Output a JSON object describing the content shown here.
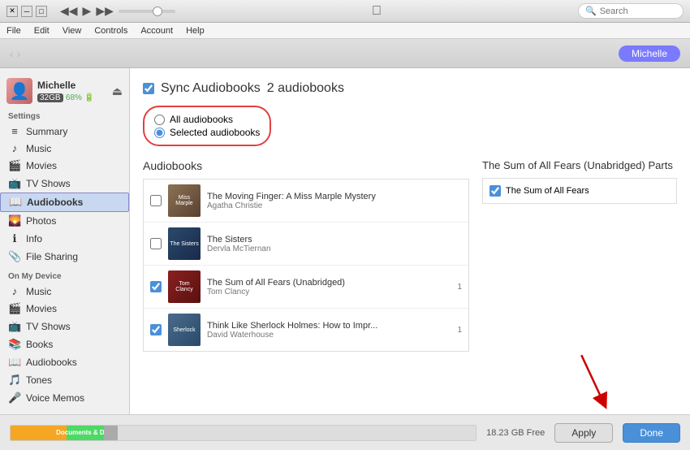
{
  "titleBar": {
    "windowControls": [
      "minimize",
      "maximize",
      "close"
    ],
    "transport": {
      "back": "◀◀",
      "play": "▶",
      "forward": "▶▶"
    },
    "appleLogoChar": "",
    "search": {
      "placeholder": "Search",
      "magnifier": "🔍"
    }
  },
  "menuBar": {
    "items": [
      "File",
      "Edit",
      "View",
      "Controls",
      "Account",
      "Help"
    ]
  },
  "navBar": {
    "backArrow": "‹",
    "forwardArrow": "›",
    "profileLabel": "Michelle"
  },
  "sidebar": {
    "device": {
      "name": "Michelle",
      "capacity": "32GB",
      "battery": "68% 🔋"
    },
    "settings": {
      "label": "Settings",
      "items": [
        {
          "id": "summary",
          "icon": "≡",
          "label": "Summary"
        },
        {
          "id": "music",
          "icon": "♪",
          "label": "Music"
        },
        {
          "id": "movies",
          "icon": "🎬",
          "label": "Movies"
        },
        {
          "id": "tvshows",
          "icon": "📺",
          "label": "TV Shows"
        },
        {
          "id": "audiobooks",
          "icon": "📖",
          "label": "Audiobooks",
          "active": true
        },
        {
          "id": "photos",
          "icon": "🌄",
          "label": "Photos"
        },
        {
          "id": "info",
          "icon": "ℹ",
          "label": "Info"
        },
        {
          "id": "filesharing",
          "icon": "📎",
          "label": "File Sharing"
        }
      ]
    },
    "onMyDevice": {
      "label": "On My Device",
      "items": [
        {
          "id": "music2",
          "icon": "♪",
          "label": "Music"
        },
        {
          "id": "movies2",
          "icon": "🎬",
          "label": "Movies"
        },
        {
          "id": "tvshows2",
          "icon": "📺",
          "label": "TV Shows"
        },
        {
          "id": "books",
          "icon": "📚",
          "label": "Books"
        },
        {
          "id": "audiobooks2",
          "icon": "📖",
          "label": "Audiobooks"
        },
        {
          "id": "tones",
          "icon": "🎵",
          "label": "Tones"
        },
        {
          "id": "voicememos",
          "icon": "🎤",
          "label": "Voice Memos"
        }
      ]
    }
  },
  "content": {
    "syncCheckbox": true,
    "syncLabel": "Sync Audiobooks",
    "syncCount": "2 audiobooks",
    "radioOptions": [
      {
        "id": "all",
        "label": "All audiobooks",
        "selected": false
      },
      {
        "id": "selected",
        "label": "Selected audiobooks",
        "selected": true
      }
    ],
    "audiobooksTitle": "Audiobooks",
    "booksColTitle": "The Sum of All Fears (Unabridged) Parts",
    "books": [
      {
        "id": 1,
        "checked": false,
        "title": "The Moving Finger: A Miss Marple Mystery",
        "author": "Agatha Christie",
        "coverClass": "cover-1",
        "count": ""
      },
      {
        "id": 2,
        "checked": false,
        "title": "The Sisters",
        "author": "Dervla McTiernan",
        "coverClass": "cover-2",
        "count": ""
      },
      {
        "id": 3,
        "checked": true,
        "title": "The Sum of All Fears (Unabridged)",
        "author": "Tom Clancy",
        "coverClass": "cover-3",
        "count": "1"
      },
      {
        "id": 4,
        "checked": true,
        "title": "Think Like Sherlock Holmes: How to Impr...",
        "author": "David Waterhouse",
        "coverClass": "cover-4",
        "count": "1"
      }
    ],
    "parts": [
      {
        "checked": true,
        "label": "The Sum of All Fears"
      }
    ]
  },
  "bottomBar": {
    "storageLabel": "Documents & Data",
    "freeSpace": "18.23 GB Free",
    "applyBtn": "Apply",
    "doneBtn": "Done",
    "segments": [
      {
        "color": "#f5a623",
        "width": "12%",
        "label": ""
      },
      {
        "color": "#4cd964",
        "width": "8%",
        "label": "Documents & Data"
      },
      {
        "color": "#888",
        "width": "3%",
        "label": ""
      }
    ]
  }
}
